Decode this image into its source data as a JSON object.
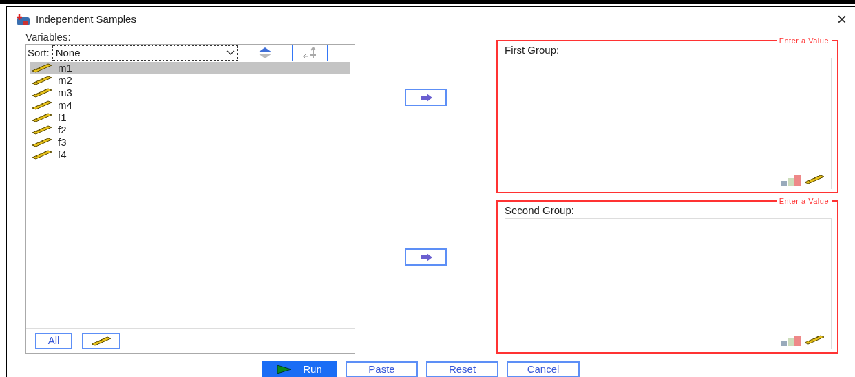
{
  "window": {
    "title": "Independent Samples",
    "close": "×"
  },
  "variables": {
    "label": "Variables:",
    "sort_label": "Sort:",
    "sort_value": "None",
    "items": [
      {
        "name": "m1",
        "selected": true
      },
      {
        "name": "m2",
        "selected": false
      },
      {
        "name": "m3",
        "selected": false
      },
      {
        "name": "m4",
        "selected": false
      },
      {
        "name": "f1",
        "selected": false
      },
      {
        "name": "f2",
        "selected": false
      },
      {
        "name": "f3",
        "selected": false
      },
      {
        "name": "f4",
        "selected": false
      }
    ],
    "buttons": [
      {
        "kind": "text",
        "label": "All"
      },
      {
        "kind": "ruler"
      }
    ]
  },
  "groups": [
    {
      "legend": "Enter a Value",
      "label": "First Group:"
    },
    {
      "legend": "Enter a Value",
      "label": "Second Group:"
    }
  ],
  "actions": [
    {
      "label": "Run",
      "kind": "primary"
    },
    {
      "label": "Paste",
      "kind": "default"
    },
    {
      "label": "Reset",
      "kind": "default"
    },
    {
      "label": "Cancel",
      "kind": "default"
    }
  ]
}
